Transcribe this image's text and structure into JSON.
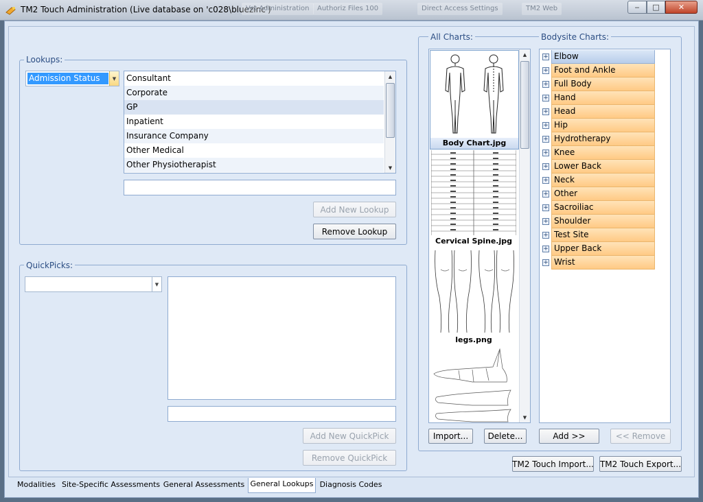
{
  "window": {
    "title": "TM2 Touch Administration (Live database on 'c028\\bluezinc')",
    "background_items": [
      "Vet Administration",
      "Authoriz Files 100",
      "Direct Access Settings",
      "TM2 Web"
    ],
    "buttons": {
      "minimize": "‒",
      "maximize": "□",
      "close": "✕"
    }
  },
  "lookups": {
    "label": "Lookups:",
    "combo_value": "Admission Status",
    "items": [
      "Consultant",
      "Corporate",
      "GP",
      "Inpatient",
      "Insurance Company",
      "Other Medical",
      "Other Physiotherapist"
    ],
    "selected_index": 2,
    "text_value": "",
    "add_button": "Add New Lookup",
    "remove_button": "Remove Lookup"
  },
  "quickpicks": {
    "label": "QuickPicks:",
    "combo_value": "",
    "text_value": "",
    "add_button": "Add New QuickPick",
    "remove_button": "Remove QuickPick"
  },
  "all_charts": {
    "label": "All Charts:",
    "items": [
      "Body Chart.jpg",
      "Cervical Spine.jpg",
      "legs.png"
    ],
    "import_button": "Import...",
    "delete_button": "Delete..."
  },
  "bodysite_charts": {
    "label": "Bodysite Charts:",
    "items": [
      "Elbow",
      "Foot and Ankle",
      "Full Body",
      "Hand",
      "Head",
      "Hip",
      "Hydrotherapy",
      "Knee",
      "Lower Back",
      "Neck",
      "Other",
      "Sacroiliac",
      "Shoulder",
      "Test Site",
      "Upper Back",
      "Wrist"
    ],
    "selected_index": 0,
    "add_button": "Add  >>",
    "remove_button": "<< Remove"
  },
  "footer_buttons": {
    "import": "TM2 Touch Import...",
    "export": "TM2 Touch Export..."
  },
  "tabs": [
    "Modalities",
    "Site-Specific Assessments",
    "General Assessments",
    "General Lookups",
    "Diagnosis Codes"
  ],
  "active_tab": "General Lookups",
  "colors": {
    "accent": "#3399ff",
    "group_label": "#2b4d83",
    "bodysite_item": "#ffca85",
    "panel_bg": "#dfe9f6"
  }
}
